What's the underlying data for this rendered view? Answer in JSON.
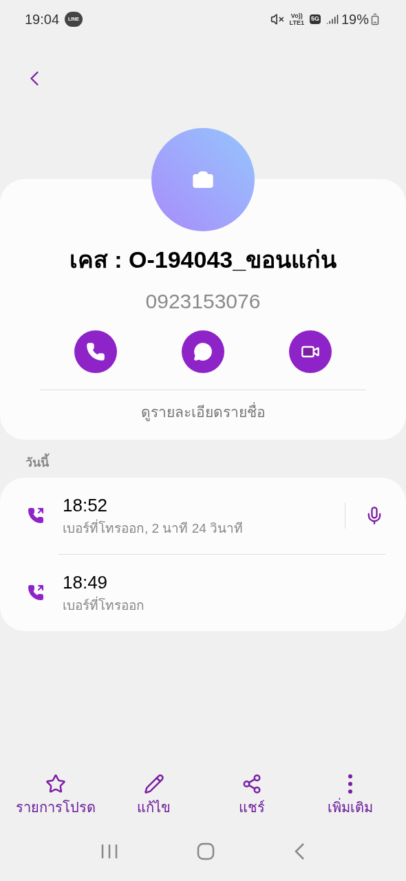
{
  "status_bar": {
    "time": "19:04",
    "app_badge": "LINE",
    "volte": "Vo))",
    "lte": "LTE1",
    "network": "5G",
    "battery": "19%"
  },
  "contact": {
    "name": "เคส : O-194043_ขอนแก่น",
    "phone": "0923153076",
    "details_link": "ดูรายละเอียดรายชื่อ"
  },
  "actions": [
    {
      "kind": "call"
    },
    {
      "kind": "message"
    },
    {
      "kind": "video"
    }
  ],
  "section_label": "วันนี้",
  "calls": [
    {
      "time": "18:52",
      "description": "เบอร์ที่โทรออก, 2 นาที 24 วินาที",
      "recording": true
    },
    {
      "time": "18:49",
      "description": "เบอร์ที่โทรออก",
      "recording": false
    }
  ],
  "bottom_actions": [
    {
      "kind": "favorite",
      "label": "รายการโปรด"
    },
    {
      "kind": "edit",
      "label": "แก้ไข"
    },
    {
      "kind": "share",
      "label": "แชร์"
    },
    {
      "kind": "more",
      "label": "เพิ่มเติม"
    }
  ]
}
